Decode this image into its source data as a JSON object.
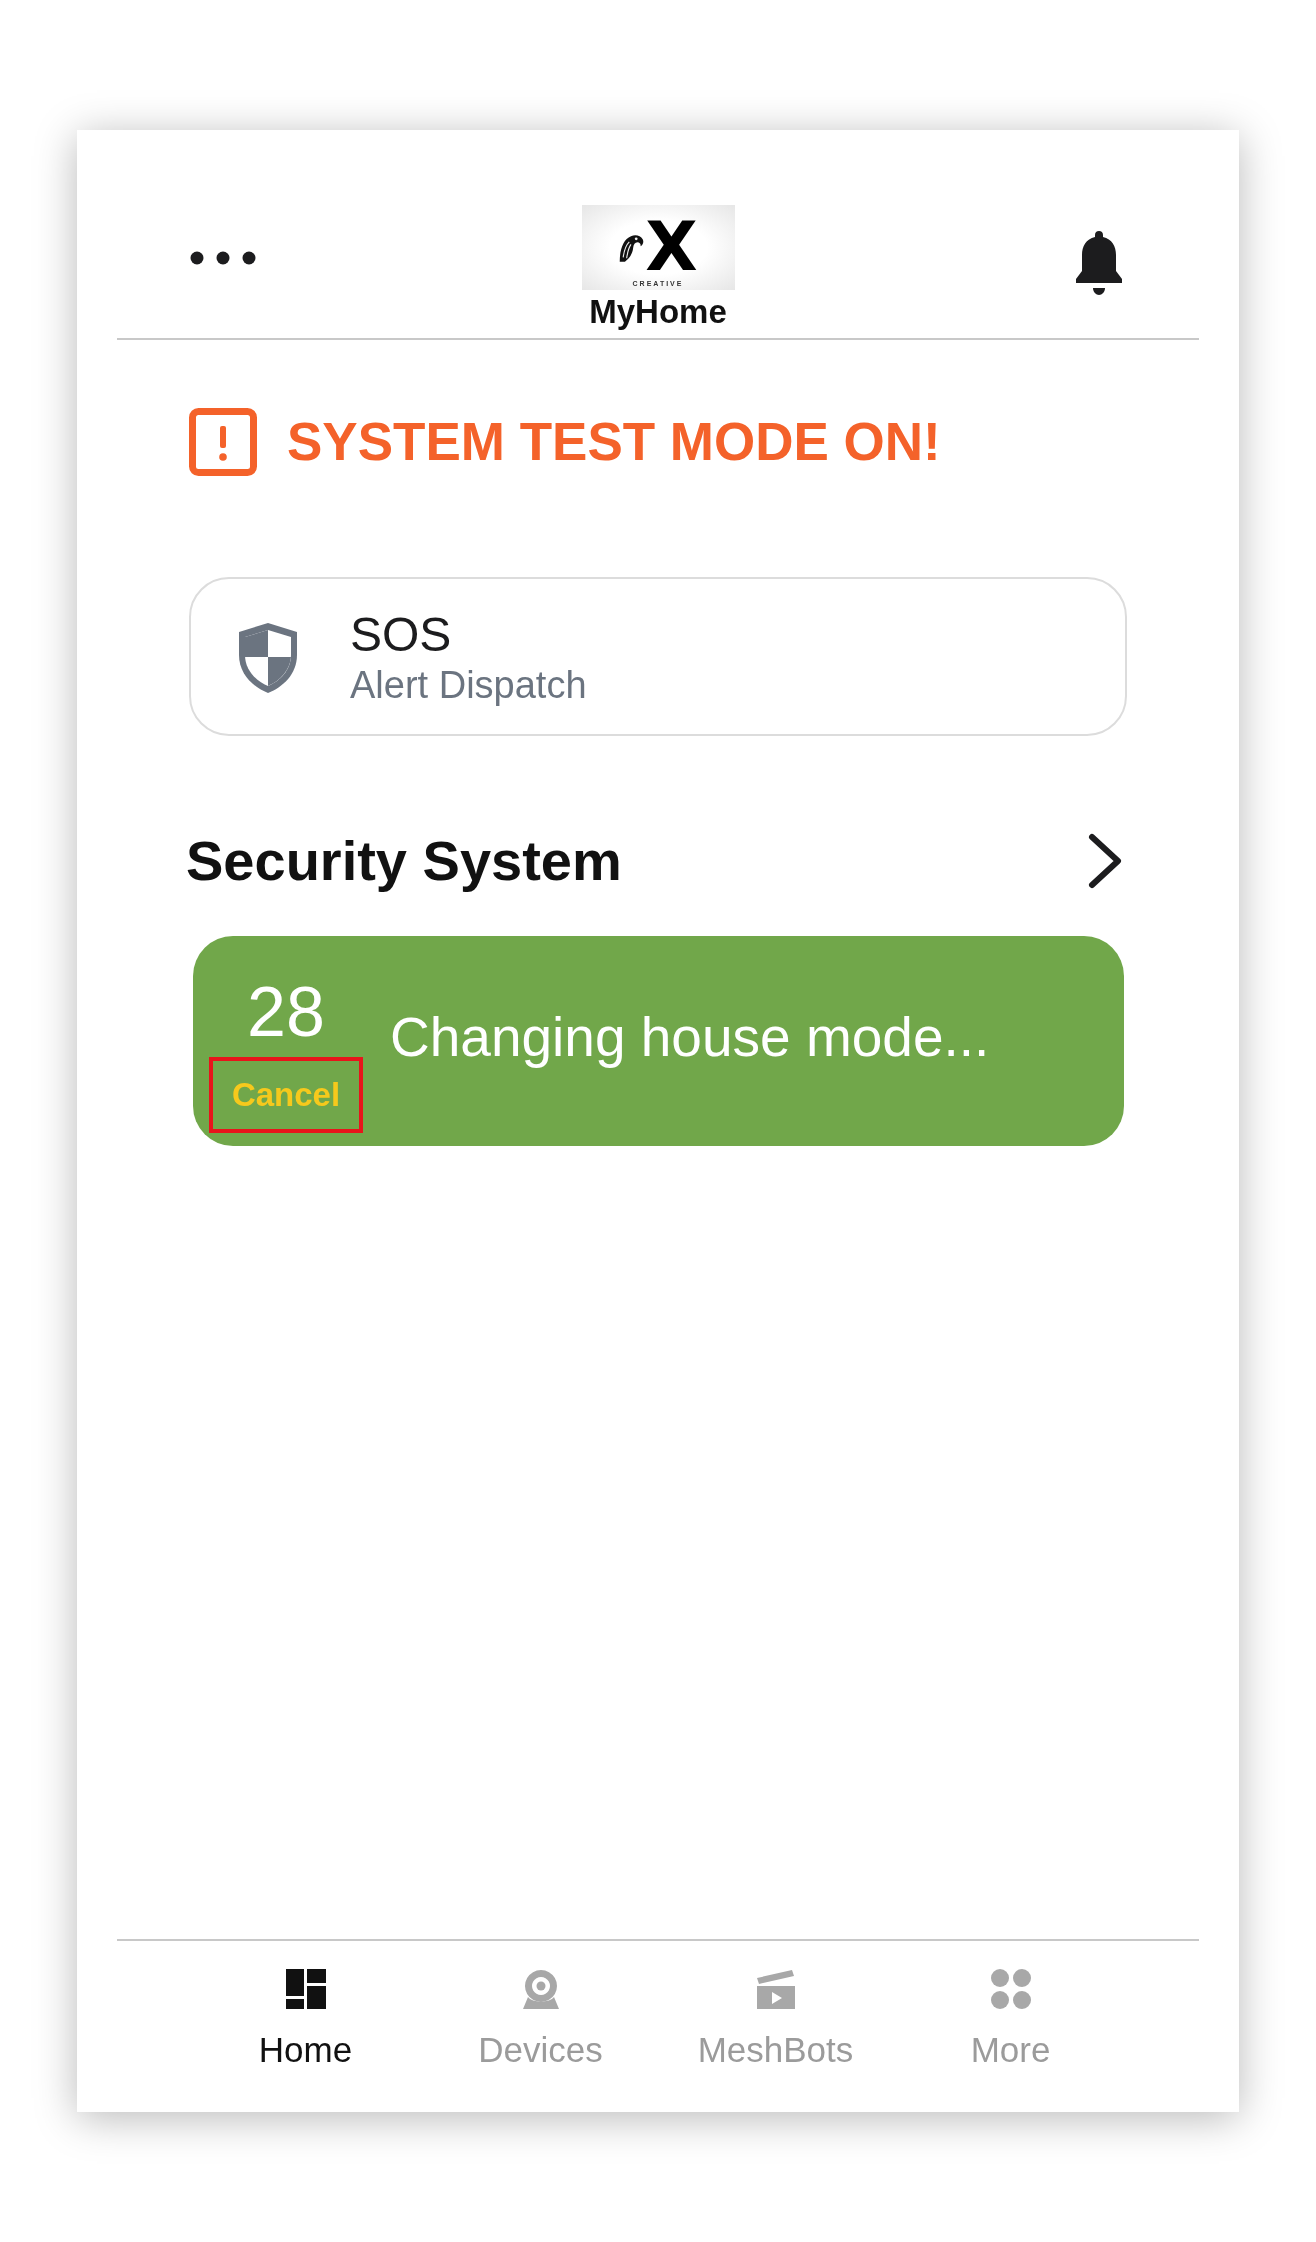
{
  "header": {
    "logo": {
      "letter": "X",
      "tagline": "CREATIVE"
    },
    "title": "MyHome"
  },
  "alert": {
    "message": "SYSTEM TEST MODE ON!"
  },
  "sos": {
    "title": "SOS",
    "subtitle": "Alert Dispatch"
  },
  "security": {
    "title": "Security System",
    "status": {
      "countdown": "28",
      "message": "Changing house mode...",
      "cancel": {
        "label": "Cancel",
        "highlighted": true
      }
    }
  },
  "nav": {
    "items": [
      {
        "label": "Home",
        "selected": true
      },
      {
        "label": "Devices",
        "selected": false
      },
      {
        "label": "MeshBots",
        "selected": false
      },
      {
        "label": "More",
        "selected": false
      }
    ]
  }
}
